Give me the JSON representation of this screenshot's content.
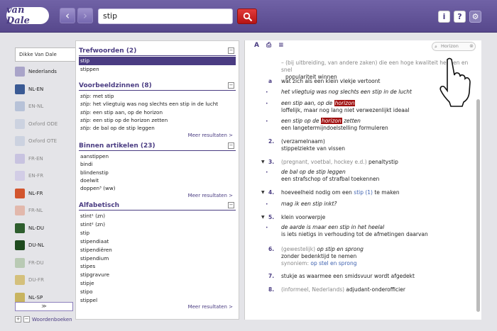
{
  "header": {
    "logo": "van Dale",
    "search_value": "stip",
    "back": "‹",
    "forward": "›",
    "info": "i",
    "help": "?",
    "gear": "⚙"
  },
  "sidebar": {
    "selected": "Dikke Van Dale",
    "items": [
      {
        "label": "Nederlands",
        "color": "#a9a4c9",
        "faded": false
      },
      {
        "label": "NL-EN",
        "color": "#3a5a94",
        "faded": false
      },
      {
        "label": "EN-NL",
        "color": "#b7c2d8",
        "faded": true
      },
      {
        "label": "Oxford ODE",
        "color": "#ccd2e0",
        "faded": true
      },
      {
        "label": "Oxford OTE",
        "color": "#ccd2e0",
        "faded": true
      },
      {
        "label": "FR-EN",
        "color": "#c8c3e0",
        "faded": true
      },
      {
        "label": "EN-FR",
        "color": "#d2cde6",
        "faded": true
      },
      {
        "label": "NL-FR",
        "color": "#d2552e",
        "faded": false
      },
      {
        "label": "FR-NL",
        "color": "#e2b8ac",
        "faded": true
      },
      {
        "label": "NL-DU",
        "color": "#2e5e2e",
        "faded": false
      },
      {
        "label": "DU-NL",
        "color": "#1e4a1e",
        "faded": false
      },
      {
        "label": "FR-DU",
        "color": "#b9cab4",
        "faded": true
      },
      {
        "label": "DU-FR",
        "color": "#d4c07c",
        "faded": true
      },
      {
        "label": "NL-SP",
        "color": "#c8b460",
        "faded": false
      }
    ],
    "expand": "≫",
    "footer": "Woordenboeken",
    "plus": "+",
    "minus": "−"
  },
  "results": {
    "trefwoorden": {
      "title": "Trefwoorden (2)",
      "rows": [
        "stip",
        "stippen"
      ]
    },
    "voorbeeldzinnen": {
      "title": "Voorbeeldzinnen (8)",
      "rows": [
        {
          "k": "stip:",
          "t": " met stip"
        },
        {
          "k": "stip:",
          "t": " het vliegtuig was nog slechts een stip in de lucht"
        },
        {
          "k": "stip:",
          "t": " een stip aan, op de horizon"
        },
        {
          "k": "stip:",
          "t": " een stip op de horizon zetten"
        },
        {
          "k": "stip:",
          "t": " de bal op de stip leggen"
        }
      ],
      "more": "Meer resultaten >"
    },
    "binnen": {
      "title": "Binnen artikelen (23)",
      "rows": [
        "aanstippen",
        "bindi",
        "blindenstip",
        "doelwit",
        "doppen³ (ww)"
      ],
      "more": "Meer resultaten >"
    },
    "alfabetisch": {
      "title": "Alfabetisch",
      "rows": [
        "stint¹ (zn)",
        "stint² (zn)",
        "stip",
        "stipendiaat",
        "stipendiëren",
        "stipendium",
        "stipes",
        "stipgravure",
        "stipje",
        "stipo",
        "stippel"
      ],
      "more": "Meer resultaten >"
    },
    "collapse": "−"
  },
  "article": {
    "tools": [
      "A",
      "⎙",
      "≡"
    ],
    "search_placeholder": "Horizon",
    "lines": {
      "l0a": "– (bij uitbreiding, van andere zaken) die een hoge kwaliteit hebben en snel",
      "l0b": "populariteit winnen",
      "a_label": "a",
      "a_text": "wat zich als een klein vlekje vertoont",
      "a_ex1": "het vliegtuig was nog slechts een stip in de lucht",
      "a_ex2a": "een stip aan, op de ",
      "a_ex2h": "horizon",
      "a_ex2b": "loffelijk, maar nog lang niet verwezenlijkt ideaal",
      "a_ex3a": "een stip op de ",
      "a_ex3h": "horizon",
      "a_ex3c": " zetten",
      "a_ex3b": "een langetermijndoelstelling formuleren",
      "n2": "2.",
      "n2a": "(verzamelnaam)",
      "n2b": "stippelziekte van vissen",
      "n3": "3.",
      "n3a": "(pregnant, voetbal, hockey e.d.)",
      "n3b": " penaltystip",
      "n3ex": "de bal op de stip leggen",
      "n3exb": "een strafschop of strafbal toekennen",
      "n4": "4.",
      "n4a": "hoeveelheid nodig om een ",
      "n4link": "stip (1)",
      "n4b": " te maken",
      "n4ex": "mag ik een stip inkt?",
      "n5": "5.",
      "n5a": "klein voorwerpje",
      "n5ex": "de aarde is maar een stip in het heelal",
      "n5exb": "is iets nietigs in verhouding tot de afmetingen daarvan",
      "n6": "6.",
      "n6a": "(gewestelijk)",
      "n6b": " op stip en sprong",
      "n6c": "zonder bedenktijd te nemen",
      "n6d": "synoniem: ",
      "n6link": "op stel en sprong",
      "n7": "7.",
      "n7a": "stukje as waarmee een smidsvuur wordt afgedekt",
      "n8": "8.",
      "n8a": "(informeel, Nederlands)",
      "n8b": " adjudant-onderofficier"
    }
  }
}
